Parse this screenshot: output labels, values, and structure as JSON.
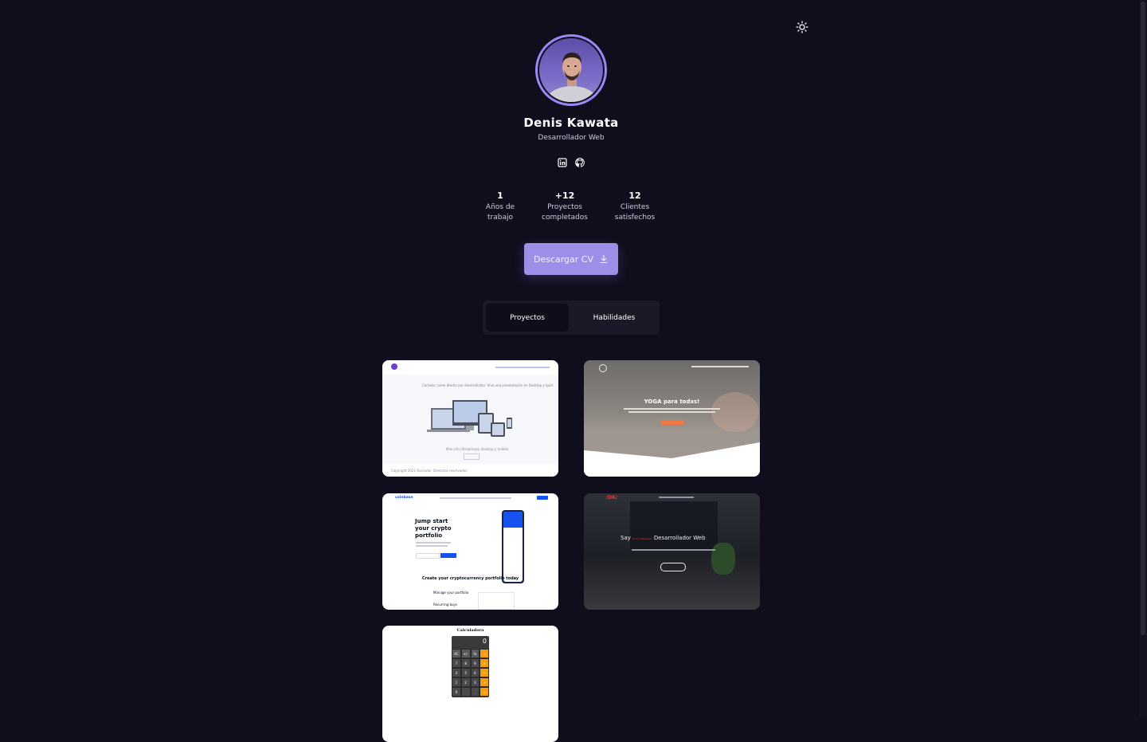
{
  "profile": {
    "name": "Denis Kawata",
    "role": "Desarrollador Web"
  },
  "icons": {
    "theme": "sun-icon",
    "social": [
      "linkedin-icon",
      "github-icon"
    ],
    "download": "download-icon"
  },
  "stats": [
    {
      "value": "1",
      "label": "Años de\ntrabajo"
    },
    {
      "value": "+12",
      "label": "Proyectos\ncompletados"
    },
    {
      "value": "12",
      "label": "Clientes\nsatisfechos"
    }
  ],
  "cv_button": {
    "label": "Descargar CV"
  },
  "tabs": [
    {
      "label": "Proyectos",
      "active": true
    },
    {
      "label": "Habilidades",
      "active": false
    }
  ],
  "projects": [
    {
      "caption": "Cortado, como diseño por desarrollador. Vive una presentación en Desktop y Ipad.",
      "subcaption": "Más info Ultraprivacy desktop y mobile",
      "footer": "Copyright 2021 Buscador. Derechos reservados"
    },
    {
      "title": "YOGA para todxs!"
    },
    {
      "brand": "coinbase",
      "headline": "Jump start your crypto portfolio",
      "subheadline": "Create your cryptocurrency portfolio today",
      "feature1": "Manage your portfolio",
      "feature2": "Recurring buys"
    },
    {
      "logo": "/DK/",
      "intro": "Say",
      "accent": "Como diseñador",
      "headline": "Desarrollador Web"
    },
    {
      "title": "Calculadora",
      "display": "0",
      "keys": [
        "AC",
        "+/-",
        "%",
        "÷",
        "7",
        "8",
        "9",
        "×",
        "4",
        "5",
        "6",
        "−",
        "1",
        "2",
        "3",
        "+",
        "0",
        "",
        ".",
        "="
      ]
    }
  ],
  "colors": {
    "background": "#100e1d",
    "accent": "#9d8fe8",
    "tab_bg": "#1b1928"
  }
}
